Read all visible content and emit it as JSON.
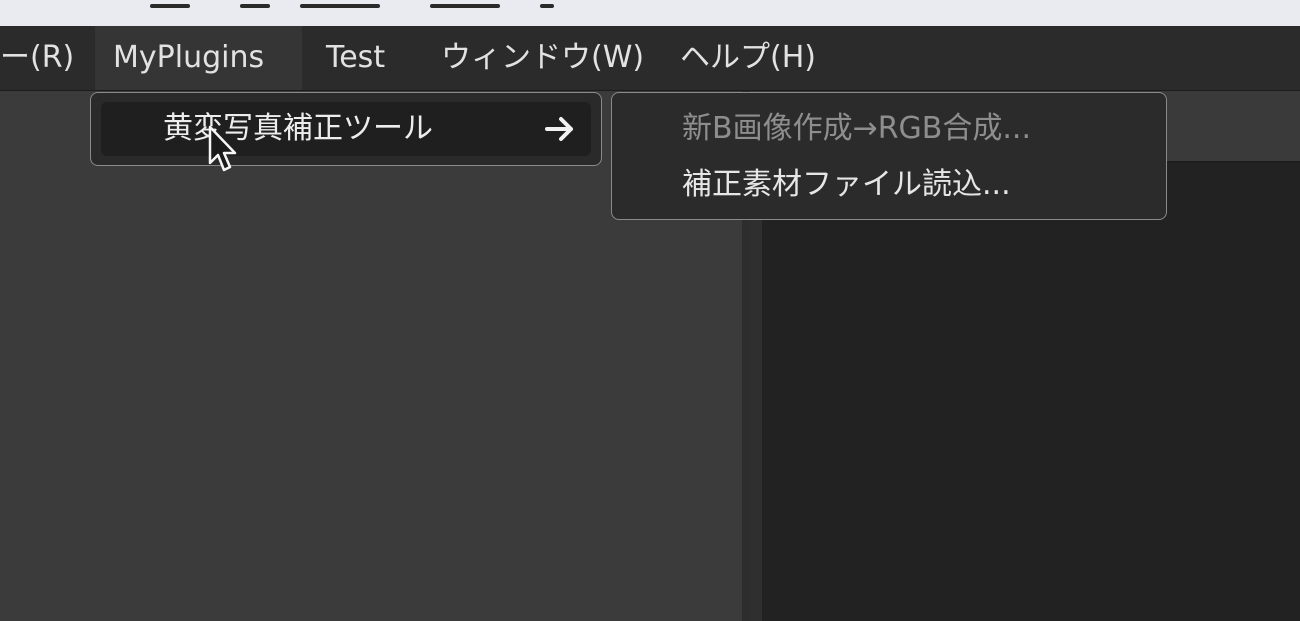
{
  "menubar": {
    "items": [
      {
        "label": "ー(R)"
      },
      {
        "label": "MyPlugins"
      },
      {
        "label": "Test"
      },
      {
        "label": "ウィンドウ(W)"
      },
      {
        "label": "ヘルプ(H)"
      }
    ]
  },
  "dropdown": {
    "items": [
      {
        "label": "黄変写真補正ツール",
        "icon": "arrow-right-icon"
      }
    ]
  },
  "submenu": {
    "items": [
      {
        "label": "新B画像作成→RGB合成...",
        "enabled": false
      },
      {
        "label": "補正素材ファイル読込...",
        "enabled": true
      }
    ]
  },
  "colors": {
    "menubar_bg": "#2b2b2b",
    "menu_text": "#e2e2e2",
    "disabled_text": "#8e8e8e",
    "panel_bg": "#3b3b3b",
    "canvas_bg": "#222222",
    "menu_border": "#8a8a8a"
  }
}
